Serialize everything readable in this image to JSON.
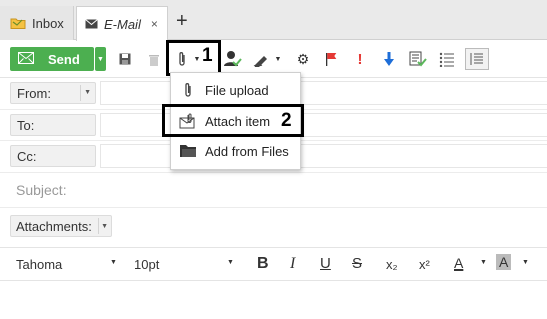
{
  "tabs": [
    {
      "label": "Inbox",
      "icon": "folder-icon"
    },
    {
      "label": "E-Mail",
      "icon": "envelope-icon",
      "close": "×"
    }
  ],
  "new_tab": "+",
  "toolbar": {
    "send_label": "Send",
    "annotation_1": "1",
    "icons": [
      "save-icon",
      "trash-icon",
      "attach-icon",
      "contacts-icon",
      "signature-icon",
      "settings-icon",
      "flag-icon",
      "priority-high-icon",
      "priority-low-icon",
      "read-receipt-icon",
      "list-icon",
      "template-icon"
    ]
  },
  "fields": {
    "from_label": "From:",
    "to_label": "To:",
    "cc_label": "Cc:",
    "subject_placeholder": "Subject:",
    "attachments_label": "Attachments:"
  },
  "format": {
    "font": "Tahoma",
    "size": "10pt",
    "bold": "B",
    "italic": "I",
    "underline": "U",
    "strike": "S",
    "subscript": "x₂",
    "superscript": "x²",
    "font_color": "A",
    "highlight": "A"
  },
  "menu": {
    "items": [
      {
        "label": "File upload",
        "icon": "paperclip-icon"
      },
      {
        "label": "Attach item",
        "icon": "attach-item-icon"
      },
      {
        "label": "Add from Files",
        "icon": "folder-icon"
      }
    ],
    "annotation_2": "2"
  },
  "colors": {
    "send": "#4caf50",
    "flag": "#e53935",
    "priority": "#1e6ed8"
  }
}
